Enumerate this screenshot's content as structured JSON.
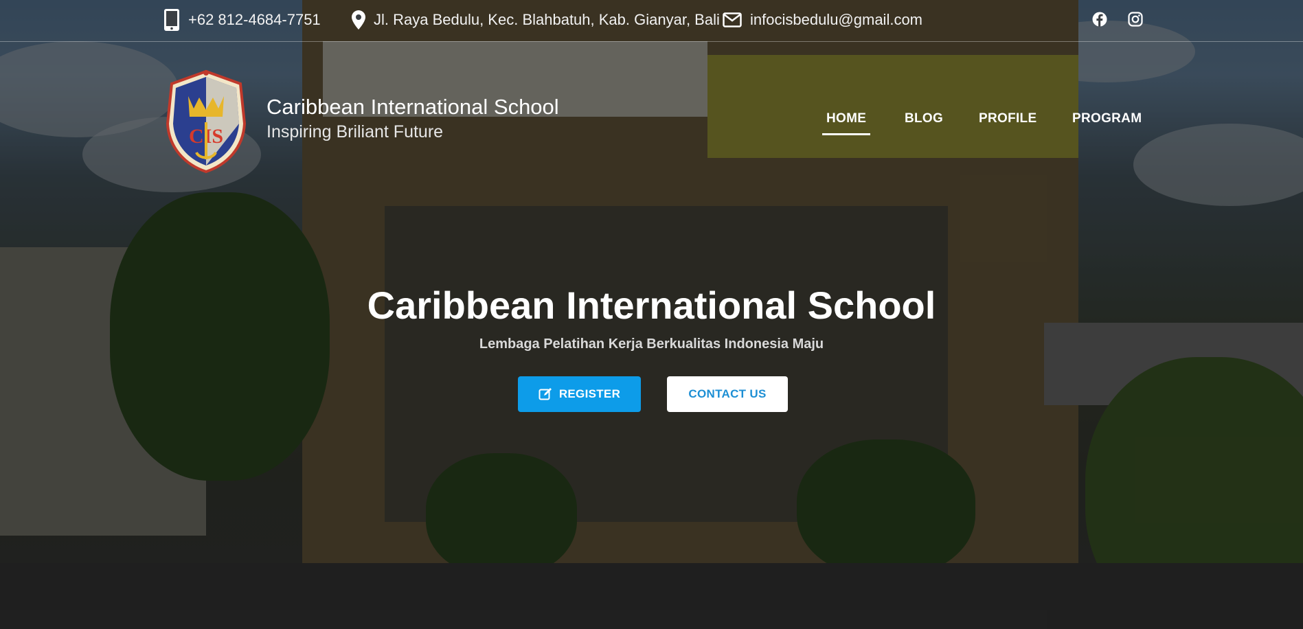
{
  "topbar": {
    "phone": "+62 812-4684-7751",
    "address": "Jl. Raya Bedulu, Kec. Blahbatuh, Kab. Gianyar, Bali",
    "email": "infocisbedulu@gmail.com",
    "icons": {
      "phone": "mobile-phone-icon",
      "address": "map-pin-icon",
      "email": "envelope-icon",
      "facebook": "facebook-icon",
      "instagram": "instagram-icon"
    }
  },
  "brand": {
    "title": "Caribbean International School",
    "subtitle": "Inspiring Briliant Future",
    "logo_text": "CIS"
  },
  "nav": {
    "items": [
      "HOME",
      "BLOG",
      "PROFILE",
      "PROGRAM"
    ],
    "active": "HOME"
  },
  "hero": {
    "title": "Caribbean International School",
    "subtitle": "Lembaga Pelatihan Kerja Berkualitas Indonesia Maju",
    "register_label": "REGISTER",
    "contact_label": "CONTACT US"
  },
  "colors": {
    "accent": "#0d9ce9",
    "contact_text": "#1d8fd4"
  }
}
